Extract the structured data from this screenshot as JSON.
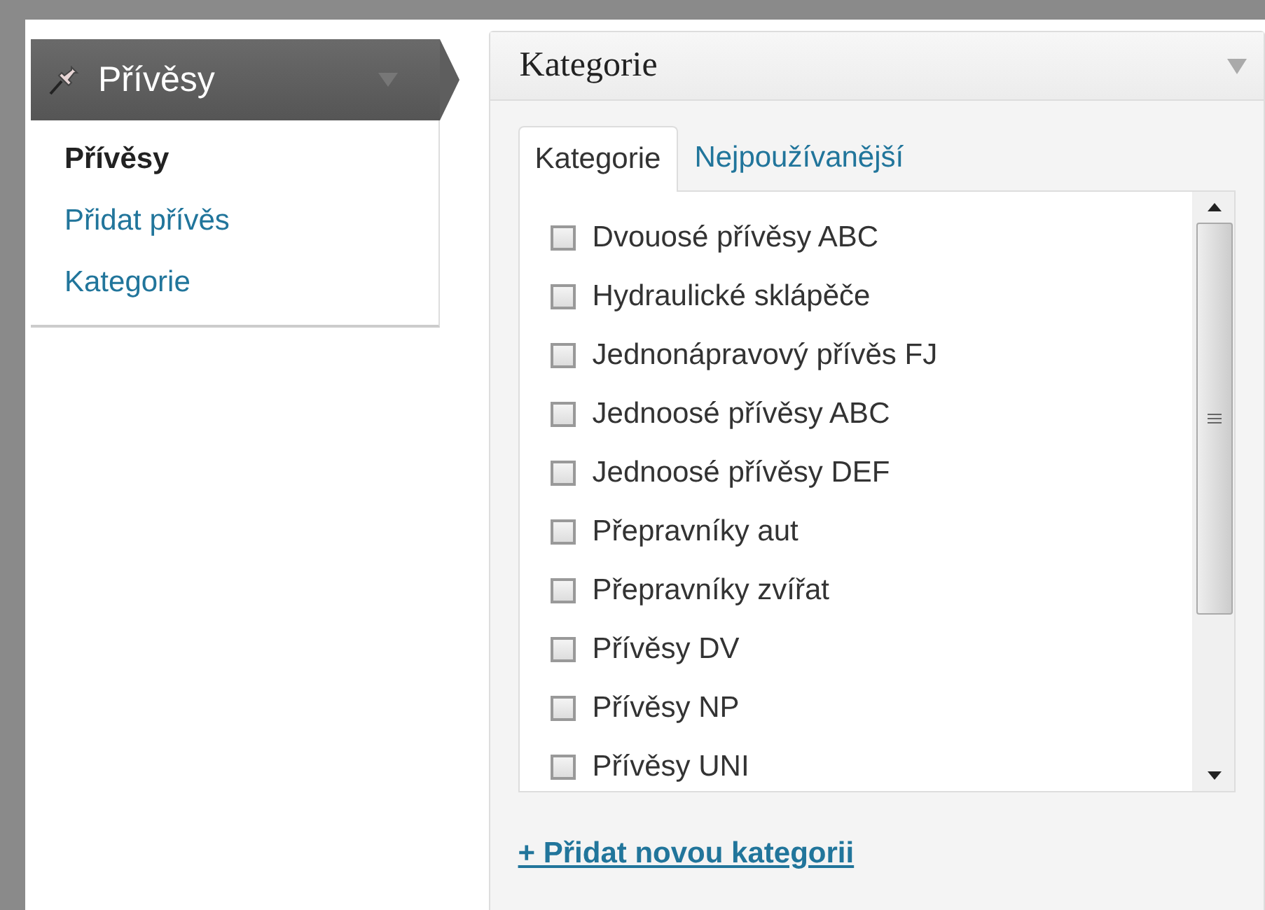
{
  "menu": {
    "title": "Přívěsy",
    "items": [
      {
        "label": "Přívěsy",
        "selected": true
      },
      {
        "label": "Přidat přívěs",
        "selected": false
      },
      {
        "label": "Kategorie",
        "selected": false
      }
    ]
  },
  "panel": {
    "title": "Kategorie",
    "tabs": [
      {
        "label": "Kategorie",
        "selected": true
      },
      {
        "label": "Nejpoužívanější",
        "selected": false
      }
    ],
    "categories": [
      {
        "label": "Dvouosé přívěsy ABC",
        "checked": false
      },
      {
        "label": "Hydraulické sklápěče",
        "checked": false
      },
      {
        "label": "Jednonápravový přívěs FJ",
        "checked": false
      },
      {
        "label": "Jednoosé přívěsy ABC",
        "checked": false
      },
      {
        "label": "Jednoosé přívěsy DEF",
        "checked": false
      },
      {
        "label": "Přepravníky aut",
        "checked": false
      },
      {
        "label": "Přepravníky zvířat",
        "checked": false
      },
      {
        "label": "Přívěsy DV",
        "checked": false
      },
      {
        "label": "Přívěsy NP",
        "checked": false
      },
      {
        "label": "Přívěsy UNI",
        "checked": false
      }
    ],
    "add_link": "+ Přidat novou kategorii"
  }
}
